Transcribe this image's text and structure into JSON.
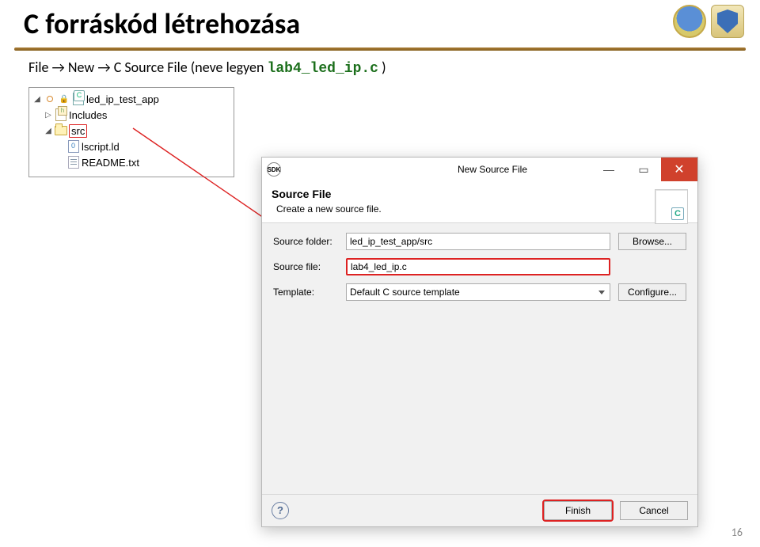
{
  "slide": {
    "title": "C forráskód létrehozása",
    "page_number": "16"
  },
  "subtitle": {
    "prefix": "File → New  → C Source File (neve legyen ",
    "filename": "lab4_led_ip.c",
    "suffix": ")"
  },
  "tree": {
    "project": "led_ip_test_app",
    "includes": "Includes",
    "src": "src",
    "lscript": "lscript.ld",
    "readme": "README.txt"
  },
  "dialog": {
    "title": "New Source File",
    "header_title": "Source File",
    "header_sub": "Create a new source file.",
    "labels": {
      "folder": "Source folder:",
      "file": "Source file:",
      "template": "Template:"
    },
    "values": {
      "folder": "led_ip_test_app/src",
      "file": "lab4_led_ip.c",
      "template": "Default C source template"
    },
    "buttons": {
      "browse": "Browse...",
      "configure": "Configure...",
      "finish": "Finish",
      "cancel": "Cancel"
    },
    "hdr_icon_letter": "C",
    "sdk_icon": "SDK"
  }
}
